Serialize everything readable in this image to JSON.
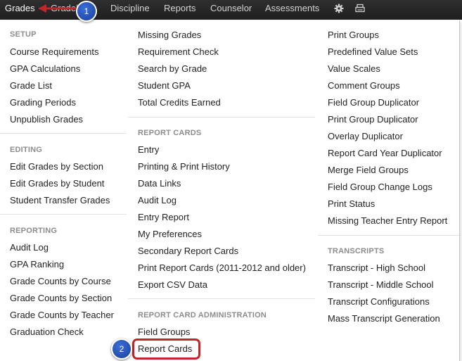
{
  "navbar": {
    "grades": "Grades",
    "gradebook": "Gradeb",
    "discipline": "Discipline",
    "reports": "Reports",
    "counselor": "Counselor",
    "assessments": "Assessments",
    "gear_icon": "gear-icon",
    "print_icon": "print-icon"
  },
  "setup": {
    "heading": "SETUP",
    "items": [
      "Course Requirements",
      "GPA Calculations",
      "Grade List",
      "Grading Periods",
      "Unpublish Grades"
    ]
  },
  "editing": {
    "heading": "EDITING",
    "items": [
      "Edit Grades by Section",
      "Edit Grades by Student",
      "Student Transfer Grades"
    ]
  },
  "reporting": {
    "heading": "REPORTING",
    "items": [
      "Audit Log",
      "GPA Ranking",
      "Grade Counts by Course",
      "Grade Counts by Section",
      "Grade Counts by Teacher",
      "Graduation Check"
    ]
  },
  "col2_top": {
    "items": [
      "Missing Grades",
      "Requirement Check",
      "Search by Grade",
      "Student GPA",
      "Total Credits Earned"
    ]
  },
  "report_cards": {
    "heading": "REPORT CARDS",
    "items": [
      "Entry",
      "Printing & Print History",
      "Data Links",
      "Audit Log",
      "Entry Report",
      "My Preferences",
      "Secondary Report Cards",
      "Print Report Cards (2011-2012 and older)",
      "Export CSV Data"
    ]
  },
  "report_card_admin": {
    "heading": "REPORT CARD ADMINISTRATION",
    "items": [
      "Field Groups",
      "Report Cards"
    ]
  },
  "col3_top": {
    "items": [
      "Print Groups",
      "Predefined Value Sets",
      "Value Scales",
      "Comment Groups",
      "Field Group Duplicator",
      "Print Group Duplicator",
      "Overlay Duplicator",
      "Report Card Year Duplicator",
      "Merge Field Groups",
      "Field Group Change Logs",
      "Print Status",
      "Missing Teacher Entry Report"
    ]
  },
  "transcripts": {
    "heading": "TRANSCRIPTS",
    "items": [
      "Transcript - High School",
      "Transcript - Middle School",
      "Transcript Configurations",
      "Mass Transcript Generation"
    ]
  },
  "callouts": {
    "step1": "1",
    "step2": "2"
  },
  "colors": {
    "callout_blue": "#1a3f9c",
    "highlight_red": "#c0272d",
    "navbar": "#262626"
  }
}
